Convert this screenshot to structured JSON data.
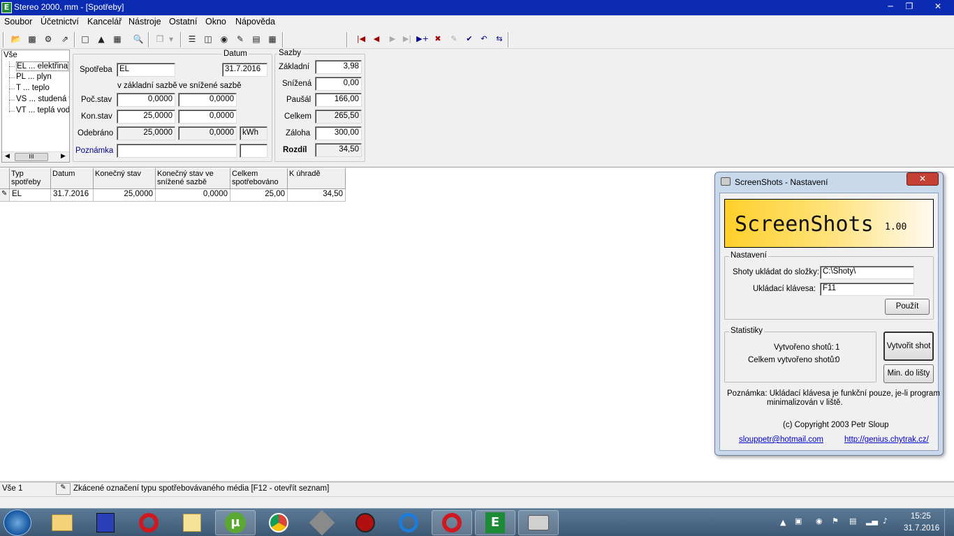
{
  "window": {
    "title": "Stereo 2000, mm - [Spotřeby]",
    "app_icon": "E"
  },
  "menu": [
    "Soubor",
    "Účetnictví",
    "Kancelář",
    "Nástroje",
    "Ostatní",
    "Okno",
    "Nápověda"
  ],
  "tree": {
    "root": "Vše",
    "items": [
      "EL ... elektřina",
      "PL ... plyn",
      "T ... teplo",
      "VS ... studená v",
      "VT ... teplá vod"
    ]
  },
  "form": {
    "spotreba_label": "Spotřeba",
    "spotreba_value": "EL",
    "datum_label": "Datum",
    "datum_value": "31.7.2016",
    "col_zakladni": "v základní sazbě",
    "col_snizene": "ve snížené sazbě",
    "poc_stav_label": "Poč.stav",
    "poc_stav_zakl": "0,0000",
    "poc_stav_sniz": "0,0000",
    "kon_stav_label": "Kon.stav",
    "kon_stav_zakl": "25,0000",
    "kon_stav_sniz": "0,0000",
    "odebrano_label": "Odebráno",
    "odebrano_zakl": "25,0000",
    "odebrano_sniz": "0,0000",
    "unit": "kWh",
    "poznamka_label": "Poznámka",
    "poznamka_value": "",
    "poznamka_extra": ""
  },
  "sazby": {
    "title": "Sazby",
    "zakladni_label": "Základní",
    "zakladni": "3,98",
    "snizena_label": "Snížená",
    "snizena": "0,00",
    "pausal_label": "Paušál",
    "pausal": "166,00",
    "celkem_label": "Celkem",
    "celkem": "265,50",
    "zaloha_label": "Záloha",
    "zaloha": "300,00",
    "rozdil_label": "Rozdíl",
    "rozdil": "34,50"
  },
  "grid": {
    "headers": [
      "Typ spotřeby",
      "Datum",
      "Konečný stav",
      "Konečný stav ve snížené sazbě",
      "Celkem spotřebováno",
      "K úhradě"
    ],
    "rows": [
      [
        "EL",
        "31.7.2016",
        "25,0000",
        "0,0000",
        "25,00",
        "34,50"
      ]
    ]
  },
  "status": {
    "left": "Vše 1",
    "hint": "Zkácené označení typu spotřebovávaného média [F12 - otevřít seznam]"
  },
  "dialog": {
    "title": "ScreenShots - Nastavení",
    "brand": "ScreenShots",
    "version": "1.00",
    "settings_group": "Nastavení",
    "folder_label": "Shoty ukládat do složky:",
    "folder_value": "C:\\Shoty\\",
    "key_label": "Ukládací klávesa:",
    "key_value": "F11",
    "apply_button": "Použít",
    "stats_group": "Statistiky",
    "created_label": "Vytvořeno shotů:",
    "created_value": "1",
    "total_label": "Celkem vytvořeno shotů:",
    "total_value": "0",
    "shot_button": "Vytvořit shot",
    "minimize_button": "Min. do lišty",
    "note_line1": "Poznámka: Ukládací klávesa je funkční pouze, je-li program",
    "note_line2": "minimalizován v liště.",
    "copyright": "(c) Copyright 2003 Petr Sloup",
    "email": "slouppetr@hotmail.com",
    "web": "http://genius.chytrak.cz/"
  },
  "taskbar": {
    "time": "15:25",
    "date": "31.7.2016"
  },
  "colors": {
    "titlebar": "#0c2bb3",
    "link": "#0000cc",
    "nav_red": "#a00000"
  }
}
